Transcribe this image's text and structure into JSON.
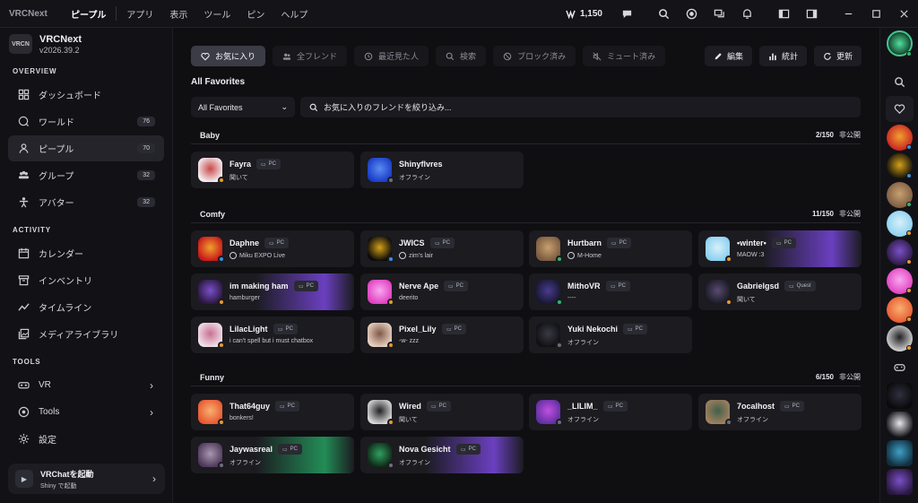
{
  "titlebar": {
    "brand": "VRCNext",
    "menu": [
      "ピープル",
      "アプリ",
      "表示",
      "ツール",
      "ピン",
      "ヘルプ"
    ],
    "vrc_credits": "1,150"
  },
  "sidebar": {
    "app_name": "VRCNext",
    "version": "v2026.39.2",
    "overview_label": "OVERVIEW",
    "activity_label": "ACTIVITY",
    "tools_label": "TOOLS",
    "overview": [
      {
        "label": "ダッシュボード",
        "badge": ""
      },
      {
        "label": "ワールド",
        "badge": "76"
      },
      {
        "label": "ピープル",
        "badge": "70"
      },
      {
        "label": "グループ",
        "badge": "32"
      },
      {
        "label": "アバター",
        "badge": "32"
      }
    ],
    "activity": [
      {
        "label": "カレンダー"
      },
      {
        "label": "インベントリ"
      },
      {
        "label": "タイムライン"
      },
      {
        "label": "メディアライブラリ"
      }
    ],
    "tools": [
      {
        "label": "VR"
      },
      {
        "label": "Tools"
      },
      {
        "label": "設定"
      }
    ],
    "launch": {
      "title": "VRChatを起動",
      "subtitle": "Shiny で起動"
    }
  },
  "main": {
    "tabs": [
      "お気に入り",
      "全フレンド",
      "最近見た人",
      "検索",
      "ブロック済み",
      "ミュート済み"
    ],
    "actions": [
      "編集",
      "統計",
      "更新"
    ],
    "pane_title": "All Favorites",
    "filter_value": "All Favorites",
    "search_placeholder": "お気に入りのフレンドを絞り込み...",
    "groups": [
      {
        "name": "Baby",
        "count": "2/150",
        "visibility": "非公開",
        "friends": [
          {
            "name": "Fayra",
            "platform": "PC",
            "status": "聞いて",
            "state": "orange",
            "colors": [
              "#f4eef2",
              "#c84848"
            ]
          },
          {
            "name": "Shinyflvres",
            "platform": "",
            "status": "オフライン",
            "state": "gray",
            "colors": [
              "#1a3cc8",
              "#5a8cf0"
            ]
          }
        ]
      },
      {
        "name": "Comfy",
        "count": "11/150",
        "visibility": "非公開",
        "friends": [
          {
            "name": "Daphne",
            "platform": "PC",
            "status": "Miku EXPO Live",
            "globe": true,
            "state": "blue",
            "colors": [
              "#c81818",
              "#f0a030"
            ]
          },
          {
            "name": "JWICS",
            "platform": "PC",
            "status": "zim's lair",
            "globe": true,
            "state": "blue",
            "colors": [
              "#0a0a0a",
              "#d4a018"
            ]
          },
          {
            "name": "Hurtbarn",
            "platform": "PC",
            "status": "M-Home",
            "globe": true,
            "state": "green",
            "colors": [
              "#7a5a40",
              "#c8a070"
            ]
          },
          {
            "name": "•winter•",
            "platform": "PC",
            "status": "MAOW :3",
            "state": "orange",
            "colors": [
              "#8ad0f0",
              "#d8f0fa"
            ],
            "bg": "purple"
          },
          {
            "name": "im making ham",
            "platform": "PC",
            "status": "hamburger",
            "state": "orange",
            "colors": [
              "#2a1840",
              "#7a50c8"
            ],
            "bg": "purple"
          },
          {
            "name": "Nerve Ape",
            "platform": "PC",
            "status": "deerito",
            "state": "orange",
            "colors": [
              "#e040c0",
              "#f8a8f0"
            ]
          },
          {
            "name": "MithoVR",
            "platform": "PC",
            "status": "----",
            "state": "green",
            "colors": [
              "#181830",
              "#4a3a90"
            ]
          },
          {
            "name": "Gabrielgsd",
            "platform": "Quest",
            "status": "聞いて",
            "state": "orange",
            "colors": [
              "#1a1a24",
              "#5a4a70"
            ]
          },
          {
            "name": "LilacLight",
            "platform": "PC",
            "status": "i can't spell but i must chatbox",
            "state": "orange",
            "colors": [
              "#f0e0e8",
              "#c87090"
            ]
          },
          {
            "name": "Pixel_Lily",
            "platform": "PC",
            "status": "-w- zzz",
            "state": "orange",
            "colors": [
              "#e8d0c0",
              "#805848"
            ]
          },
          {
            "name": "Yuki Nekochi",
            "platform": "PC",
            "status": "オフライン",
            "state": "gray",
            "colors": [
              "#101014",
              "#3a3a44"
            ]
          }
        ]
      },
      {
        "name": "Funny",
        "count": "6/150",
        "visibility": "非公開",
        "friends": [
          {
            "name": "That64guy",
            "platform": "PC",
            "status": "bonkers!",
            "state": "orange",
            "colors": [
              "#e85830",
              "#f8b070"
            ]
          },
          {
            "name": "Wired",
            "platform": "PC",
            "status": "聞いて",
            "state": "orange",
            "colors": [
              "#d8d8d8",
              "#202024"
            ]
          },
          {
            "name": "_LILIM_",
            "platform": "PC",
            "status": "オフライン",
            "state": "gray",
            "colors": [
              "#6030a0",
              "#c050e0"
            ]
          },
          {
            "name": "7ocalhost",
            "platform": "PC",
            "status": "オフライン",
            "state": "gray",
            "colors": [
              "#a08060",
              "#406048"
            ]
          },
          {
            "name": "Jaywasreal",
            "platform": "PC",
            "status": "オフライン",
            "state": "gray",
            "colors": [
              "#50385a",
              "#a898b0"
            ],
            "bg": "green"
          },
          {
            "name": "Nova Gesicht",
            "platform": "PC",
            "status": "オフライン",
            "state": "gray",
            "colors": [
              "#102818",
              "#30a060"
            ],
            "bg": "purple"
          }
        ]
      }
    ]
  },
  "rail": {
    "avatars": [
      {
        "colors": [
          "#c82020",
          "#f0a030"
        ],
        "state": "blue"
      },
      {
        "colors": [
          "#0a0a0a",
          "#d4a018"
        ],
        "state": "blue"
      },
      {
        "colors": [
          "#7a5a40",
          "#c8a070"
        ],
        "state": "green"
      },
      {
        "colors": [
          "#8ad0f0",
          "#d8f0fa"
        ],
        "state": "orange"
      },
      {
        "colors": [
          "#2a1840",
          "#7a50c8"
        ],
        "state": "orange"
      },
      {
        "colors": [
          "#e040c0",
          "#f8a8f0"
        ],
        "state": "orange"
      },
      {
        "colors": [
          "#e85830",
          "#f8b070"
        ],
        "state": "orange"
      },
      {
        "colors": [
          "#d8d8d8",
          "#202024"
        ],
        "state": "orange"
      }
    ],
    "apps": [
      {
        "colors": [
          "#0a0a0c",
          "#303040"
        ]
      },
      {
        "colors": [
          "#101014",
          "#e8e8ec"
        ]
      },
      {
        "colors": [
          "#103040",
          "#40a0c8"
        ]
      },
      {
        "colors": [
          "#2a1840",
          "#7a50c8"
        ]
      }
    ]
  }
}
